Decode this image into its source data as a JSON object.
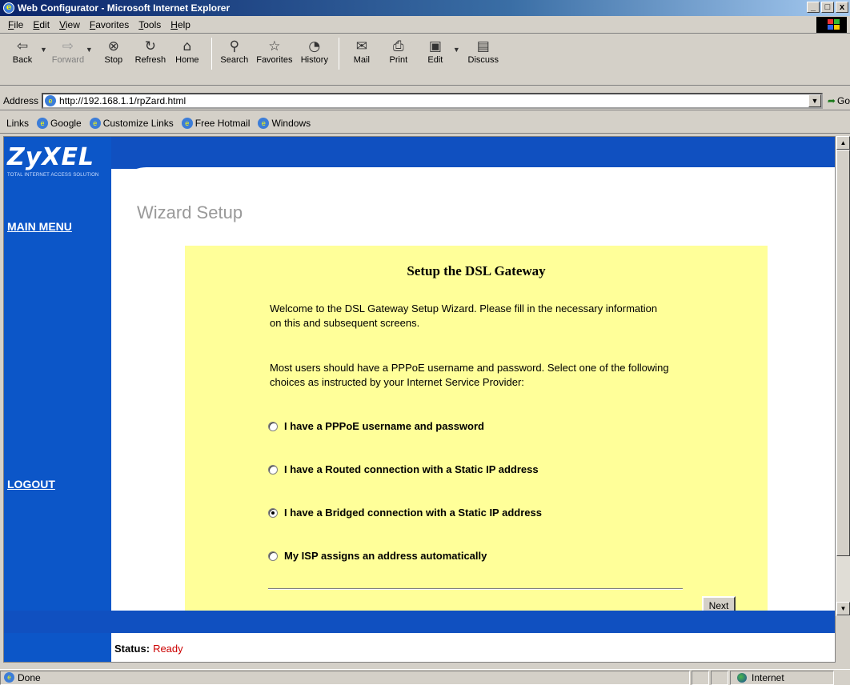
{
  "window": {
    "title": "Web Configurator - Microsoft Internet Explorer",
    "controls": [
      "_",
      "□",
      "x"
    ]
  },
  "menu": [
    "File",
    "Edit",
    "View",
    "Favorites",
    "Tools",
    "Help"
  ],
  "toolbar": {
    "back": "Back",
    "forward": "Forward",
    "stop": "Stop",
    "refresh": "Refresh",
    "home": "Home",
    "search": "Search",
    "favorites": "Favorites",
    "history": "History",
    "mail": "Mail",
    "print": "Print",
    "edit": "Edit",
    "discuss": "Discuss"
  },
  "address": {
    "label": "Address",
    "url": "http://192.168.1.1/rpZard.html",
    "go": "Go"
  },
  "links": {
    "label": "Links",
    "items": [
      "Google",
      "Customize Links",
      "Free Hotmail",
      "Windows"
    ]
  },
  "page": {
    "logo": "ZyXEL",
    "logo_tagline": "TOTAL INTERNET ACCESS SOLUTION",
    "main_menu": "MAIN MENU",
    "logout": "LOGOUT",
    "wizard_title": "Wizard Setup",
    "setup_title": "Setup the DSL Gateway",
    "intro": "Welcome to the DSL Gateway Setup Wizard. Please fill in the necessary information on this and subsequent screens.",
    "instructions": "Most users should have a PPPoE username and password. Select one of the following choices as instructed by your Internet Service Provider:",
    "options": [
      {
        "label": "I have a PPPoE username and password",
        "checked": false
      },
      {
        "label": "I have a Routed connection with a Static IP address",
        "checked": false
      },
      {
        "label": "I have a Bridged connection with a Static IP address",
        "checked": true
      },
      {
        "label": "My ISP assigns an address automatically",
        "checked": false
      }
    ],
    "next": "Next",
    "status_label": "Status:",
    "status_value": "Ready"
  },
  "statusbar": {
    "text": "Done",
    "zone": "Internet"
  },
  "colors": {
    "sidebar": "#0c56c8",
    "panel": "#ffff99",
    "status_value": "#cc0000"
  }
}
